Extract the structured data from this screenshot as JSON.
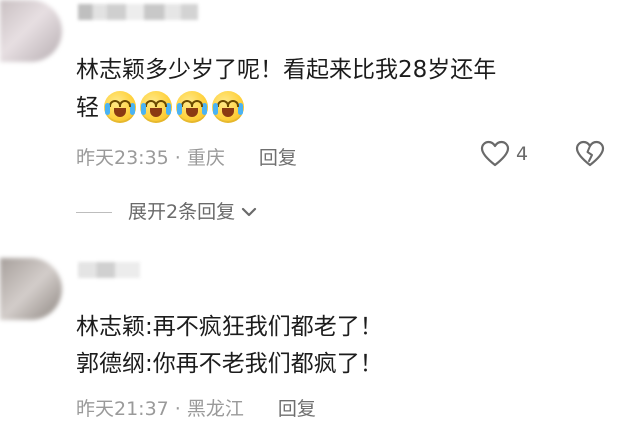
{
  "comment_1": {
    "text_line_1": "林志颖多少岁了呢！看起来比我28岁还年",
    "text_line_2": "轻",
    "emoji_names": [
      "crying-laughing-emoji",
      "crying-laughing-emoji",
      "crying-laughing-emoji",
      "crying-laughing-emoji"
    ],
    "time": "昨天23:35",
    "separator": "·",
    "location": "重庆",
    "reply_label": "回复",
    "like_icon": "heart-icon",
    "like_count": "4",
    "dislike_icon": "broken-heart-icon",
    "expand_label": "展开2条回复",
    "expand_icon": "chevron-down-icon"
  },
  "comment_2": {
    "text_line_1": "林志颖:再不疯狂我们都老了！",
    "text_line_2": "郭德纲:你再不老我们都疯了！",
    "time": "昨天21:37",
    "separator": "·",
    "location": "黑龙江",
    "reply_label": "回复"
  },
  "colors": {
    "text": "#1c1c1c",
    "meta": "#9a9a9a",
    "icon": "#6a6a6a",
    "background": "#ffffff"
  }
}
